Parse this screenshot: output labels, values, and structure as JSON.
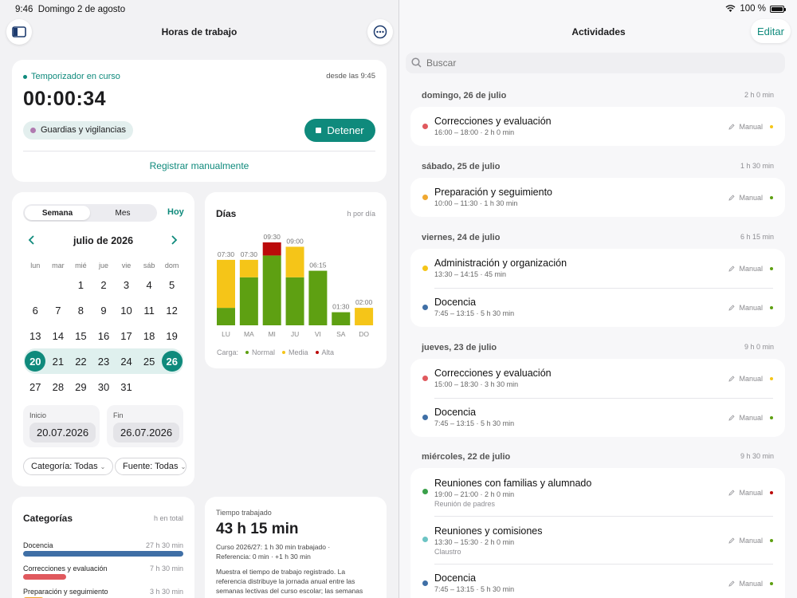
{
  "status": {
    "time": "9:46",
    "date": "Domingo 2 de agosto",
    "battery": "100 %"
  },
  "left": {
    "title": "Horas de trabajo",
    "timer": {
      "label": "Temporizador en curso",
      "since": "desde las 9:45",
      "elapsed": "00:00:34",
      "category": "Guardias y vigilancias",
      "stop_label": "Detener",
      "manual_label": "Registrar manualmente"
    },
    "calendar": {
      "segments": [
        "Semana",
        "Mes"
      ],
      "today_label": "Hoy",
      "month": "julio de 2026",
      "weekdays": [
        "lun",
        "mar",
        "mié",
        "jue",
        "vie",
        "sáb",
        "dom"
      ],
      "weeks": [
        [
          "",
          "",
          "1",
          "2",
          "3",
          "4",
          "5"
        ],
        [
          "6",
          "7",
          "8",
          "9",
          "10",
          "11",
          "12"
        ],
        [
          "13",
          "14",
          "15",
          "16",
          "17",
          "18",
          "19"
        ],
        [
          "20",
          "21",
          "22",
          "23",
          "24",
          "25",
          "26"
        ],
        [
          "27",
          "28",
          "29",
          "30",
          "31",
          "",
          ""
        ]
      ],
      "start_label": "Inicio",
      "start_value": "20.07.2026",
      "end_label": "Fin",
      "end_value": "26.07.2026",
      "filter_category": "Categoría: Todas",
      "filter_source": "Fuente: Todas"
    },
    "days_card": {
      "title": "Días",
      "unit": "h por día",
      "legend_prefix": "Carga:"
    },
    "categories_card": {
      "title": "Categorías",
      "unit": "h en total",
      "items": [
        {
          "name": "Docencia",
          "value": "27 h 30 min",
          "fraction": 1.0,
          "color": "#3f6fa6"
        },
        {
          "name": "Correcciones y evaluación",
          "value": "7 h 30 min",
          "fraction": 0.27,
          "color": "#e0595e"
        },
        {
          "name": "Preparación y seguimiento",
          "value": "3 h 30 min",
          "fraction": 0.13,
          "color": "#f0a830"
        }
      ]
    },
    "worked_card": {
      "label": "Tiempo trabajado",
      "value": "43 h 15 min",
      "line1": "Curso 2026/27: 1 h 30 min trabajado ·",
      "line2": "Referencia: 0 min · +1 h 30 min",
      "para": [
        "Muestra el tiempo de trabajo registrado. La",
        "referencia distribuye la jornada anual entre las",
        "semanas lectivas del curso escolar; las semanas"
      ]
    }
  },
  "chart_data": {
    "type": "bar",
    "title": "Días",
    "ylabel": "h por día",
    "categories": [
      "LU",
      "MA",
      "MI",
      "JU",
      "VI",
      "SA",
      "DO"
    ],
    "totals_label": [
      "07:30",
      "07:30",
      "09:30",
      "09:00",
      "06:15",
      "01:30",
      "02:00"
    ],
    "series": [
      {
        "name": "Normal",
        "color": "#5ea012",
        "values": [
          2.0,
          5.5,
          8.0,
          5.5,
          6.25,
          1.5,
          0
        ]
      },
      {
        "name": "Media",
        "color": "#f5c518",
        "values": [
          5.5,
          2.0,
          0,
          3.5,
          0,
          0,
          2.0
        ]
      },
      {
        "name": "Alta",
        "color": "#bb0a0a",
        "values": [
          0,
          0,
          1.5,
          0,
          0,
          0,
          0
        ]
      }
    ],
    "ylim": [
      0,
      9.5
    ],
    "legend": "bottom"
  },
  "right": {
    "title": "Actividades",
    "edit_label": "Editar",
    "search_placeholder": "Buscar",
    "groups": [
      {
        "date": "domingo, 26 de julio",
        "total": "2 h 0 min",
        "items": [
          {
            "title": "Correcciones y evaluación",
            "sub": "16:00 – 18:00 · 2 h 0 min",
            "note": "",
            "source": "Manual",
            "color": "#e0595e",
            "load": "#f5c518"
          }
        ]
      },
      {
        "date": "sábado, 25 de julio",
        "total": "1 h 30 min",
        "items": [
          {
            "title": "Preparación y seguimiento",
            "sub": "10:00 – 11:30 · 1 h 30 min",
            "note": "",
            "source": "Manual",
            "color": "#f0a830",
            "load": "#5ea012"
          }
        ]
      },
      {
        "date": "viernes, 24 de julio",
        "total": "6 h 15 min",
        "items": [
          {
            "title": "Administración y organización",
            "sub": "13:30 – 14:15 · 45 min",
            "note": "",
            "source": "Manual",
            "color": "#f5c518",
            "load": "#5ea012"
          },
          {
            "title": "Docencia",
            "sub": "7:45 – 13:15 · 5 h 30 min",
            "note": "",
            "source": "Manual",
            "color": "#3f6fa6",
            "load": "#5ea012"
          }
        ]
      },
      {
        "date": "jueves, 23 de julio",
        "total": "9 h 0 min",
        "items": [
          {
            "title": "Correcciones y evaluación",
            "sub": "15:00 – 18:30 · 3 h 30 min",
            "note": "",
            "source": "Manual",
            "color": "#e0595e",
            "load": "#f5c518"
          },
          {
            "title": "Docencia",
            "sub": "7:45 – 13:15 · 5 h 30 min",
            "note": "",
            "source": "Manual",
            "color": "#3f6fa6",
            "load": "#5ea012"
          }
        ]
      },
      {
        "date": "miércoles, 22 de julio",
        "total": "9 h 30 min",
        "items": [
          {
            "title": "Reuniones con familias y alumnado",
            "sub": "19:00 – 21:00 · 2 h 0 min",
            "note": "Reunión de padres",
            "source": "Manual",
            "color": "#3aa04a",
            "load": "#bb0a0a"
          },
          {
            "title": "Reuniones y comisiones",
            "sub": "13:30 – 15:30 · 2 h 0 min",
            "note": "Claustro",
            "source": "Manual",
            "color": "#6cc4c4",
            "load": "#5ea012"
          },
          {
            "title": "Docencia",
            "sub": "7:45 – 13:15 · 5 h 30 min",
            "note": "",
            "source": "Manual",
            "color": "#3f6fa6",
            "load": "#5ea012"
          }
        ]
      }
    ]
  }
}
